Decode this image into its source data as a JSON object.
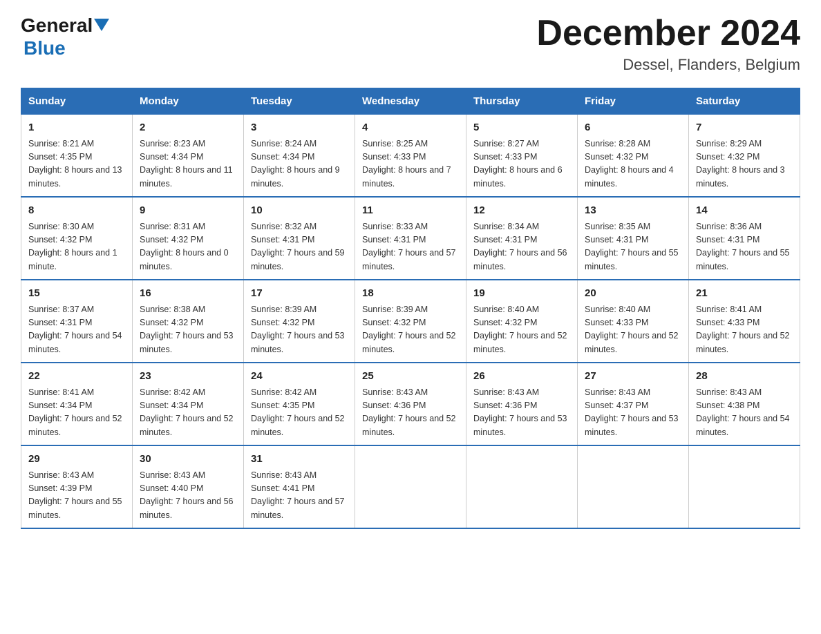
{
  "header": {
    "logo_general": "General",
    "logo_blue": "Blue",
    "month_title": "December 2024",
    "location": "Dessel, Flanders, Belgium"
  },
  "days_of_week": [
    "Sunday",
    "Monday",
    "Tuesday",
    "Wednesday",
    "Thursday",
    "Friday",
    "Saturday"
  ],
  "weeks": [
    [
      {
        "day": "1",
        "sunrise": "8:21 AM",
        "sunset": "4:35 PM",
        "daylight": "8 hours and 13 minutes."
      },
      {
        "day": "2",
        "sunrise": "8:23 AM",
        "sunset": "4:34 PM",
        "daylight": "8 hours and 11 minutes."
      },
      {
        "day": "3",
        "sunrise": "8:24 AM",
        "sunset": "4:34 PM",
        "daylight": "8 hours and 9 minutes."
      },
      {
        "day": "4",
        "sunrise": "8:25 AM",
        "sunset": "4:33 PM",
        "daylight": "8 hours and 7 minutes."
      },
      {
        "day": "5",
        "sunrise": "8:27 AM",
        "sunset": "4:33 PM",
        "daylight": "8 hours and 6 minutes."
      },
      {
        "day": "6",
        "sunrise": "8:28 AM",
        "sunset": "4:32 PM",
        "daylight": "8 hours and 4 minutes."
      },
      {
        "day": "7",
        "sunrise": "8:29 AM",
        "sunset": "4:32 PM",
        "daylight": "8 hours and 3 minutes."
      }
    ],
    [
      {
        "day": "8",
        "sunrise": "8:30 AM",
        "sunset": "4:32 PM",
        "daylight": "8 hours and 1 minute."
      },
      {
        "day": "9",
        "sunrise": "8:31 AM",
        "sunset": "4:32 PM",
        "daylight": "8 hours and 0 minutes."
      },
      {
        "day": "10",
        "sunrise": "8:32 AM",
        "sunset": "4:31 PM",
        "daylight": "7 hours and 59 minutes."
      },
      {
        "day": "11",
        "sunrise": "8:33 AM",
        "sunset": "4:31 PM",
        "daylight": "7 hours and 57 minutes."
      },
      {
        "day": "12",
        "sunrise": "8:34 AM",
        "sunset": "4:31 PM",
        "daylight": "7 hours and 56 minutes."
      },
      {
        "day": "13",
        "sunrise": "8:35 AM",
        "sunset": "4:31 PM",
        "daylight": "7 hours and 55 minutes."
      },
      {
        "day": "14",
        "sunrise": "8:36 AM",
        "sunset": "4:31 PM",
        "daylight": "7 hours and 55 minutes."
      }
    ],
    [
      {
        "day": "15",
        "sunrise": "8:37 AM",
        "sunset": "4:31 PM",
        "daylight": "7 hours and 54 minutes."
      },
      {
        "day": "16",
        "sunrise": "8:38 AM",
        "sunset": "4:32 PM",
        "daylight": "7 hours and 53 minutes."
      },
      {
        "day": "17",
        "sunrise": "8:39 AM",
        "sunset": "4:32 PM",
        "daylight": "7 hours and 53 minutes."
      },
      {
        "day": "18",
        "sunrise": "8:39 AM",
        "sunset": "4:32 PM",
        "daylight": "7 hours and 52 minutes."
      },
      {
        "day": "19",
        "sunrise": "8:40 AM",
        "sunset": "4:32 PM",
        "daylight": "7 hours and 52 minutes."
      },
      {
        "day": "20",
        "sunrise": "8:40 AM",
        "sunset": "4:33 PM",
        "daylight": "7 hours and 52 minutes."
      },
      {
        "day": "21",
        "sunrise": "8:41 AM",
        "sunset": "4:33 PM",
        "daylight": "7 hours and 52 minutes."
      }
    ],
    [
      {
        "day": "22",
        "sunrise": "8:41 AM",
        "sunset": "4:34 PM",
        "daylight": "7 hours and 52 minutes."
      },
      {
        "day": "23",
        "sunrise": "8:42 AM",
        "sunset": "4:34 PM",
        "daylight": "7 hours and 52 minutes."
      },
      {
        "day": "24",
        "sunrise": "8:42 AM",
        "sunset": "4:35 PM",
        "daylight": "7 hours and 52 minutes."
      },
      {
        "day": "25",
        "sunrise": "8:43 AM",
        "sunset": "4:36 PM",
        "daylight": "7 hours and 52 minutes."
      },
      {
        "day": "26",
        "sunrise": "8:43 AM",
        "sunset": "4:36 PM",
        "daylight": "7 hours and 53 minutes."
      },
      {
        "day": "27",
        "sunrise": "8:43 AM",
        "sunset": "4:37 PM",
        "daylight": "7 hours and 53 minutes."
      },
      {
        "day": "28",
        "sunrise": "8:43 AM",
        "sunset": "4:38 PM",
        "daylight": "7 hours and 54 minutes."
      }
    ],
    [
      {
        "day": "29",
        "sunrise": "8:43 AM",
        "sunset": "4:39 PM",
        "daylight": "7 hours and 55 minutes."
      },
      {
        "day": "30",
        "sunrise": "8:43 AM",
        "sunset": "4:40 PM",
        "daylight": "7 hours and 56 minutes."
      },
      {
        "day": "31",
        "sunrise": "8:43 AM",
        "sunset": "4:41 PM",
        "daylight": "7 hours and 57 minutes."
      },
      null,
      null,
      null,
      null
    ]
  ]
}
